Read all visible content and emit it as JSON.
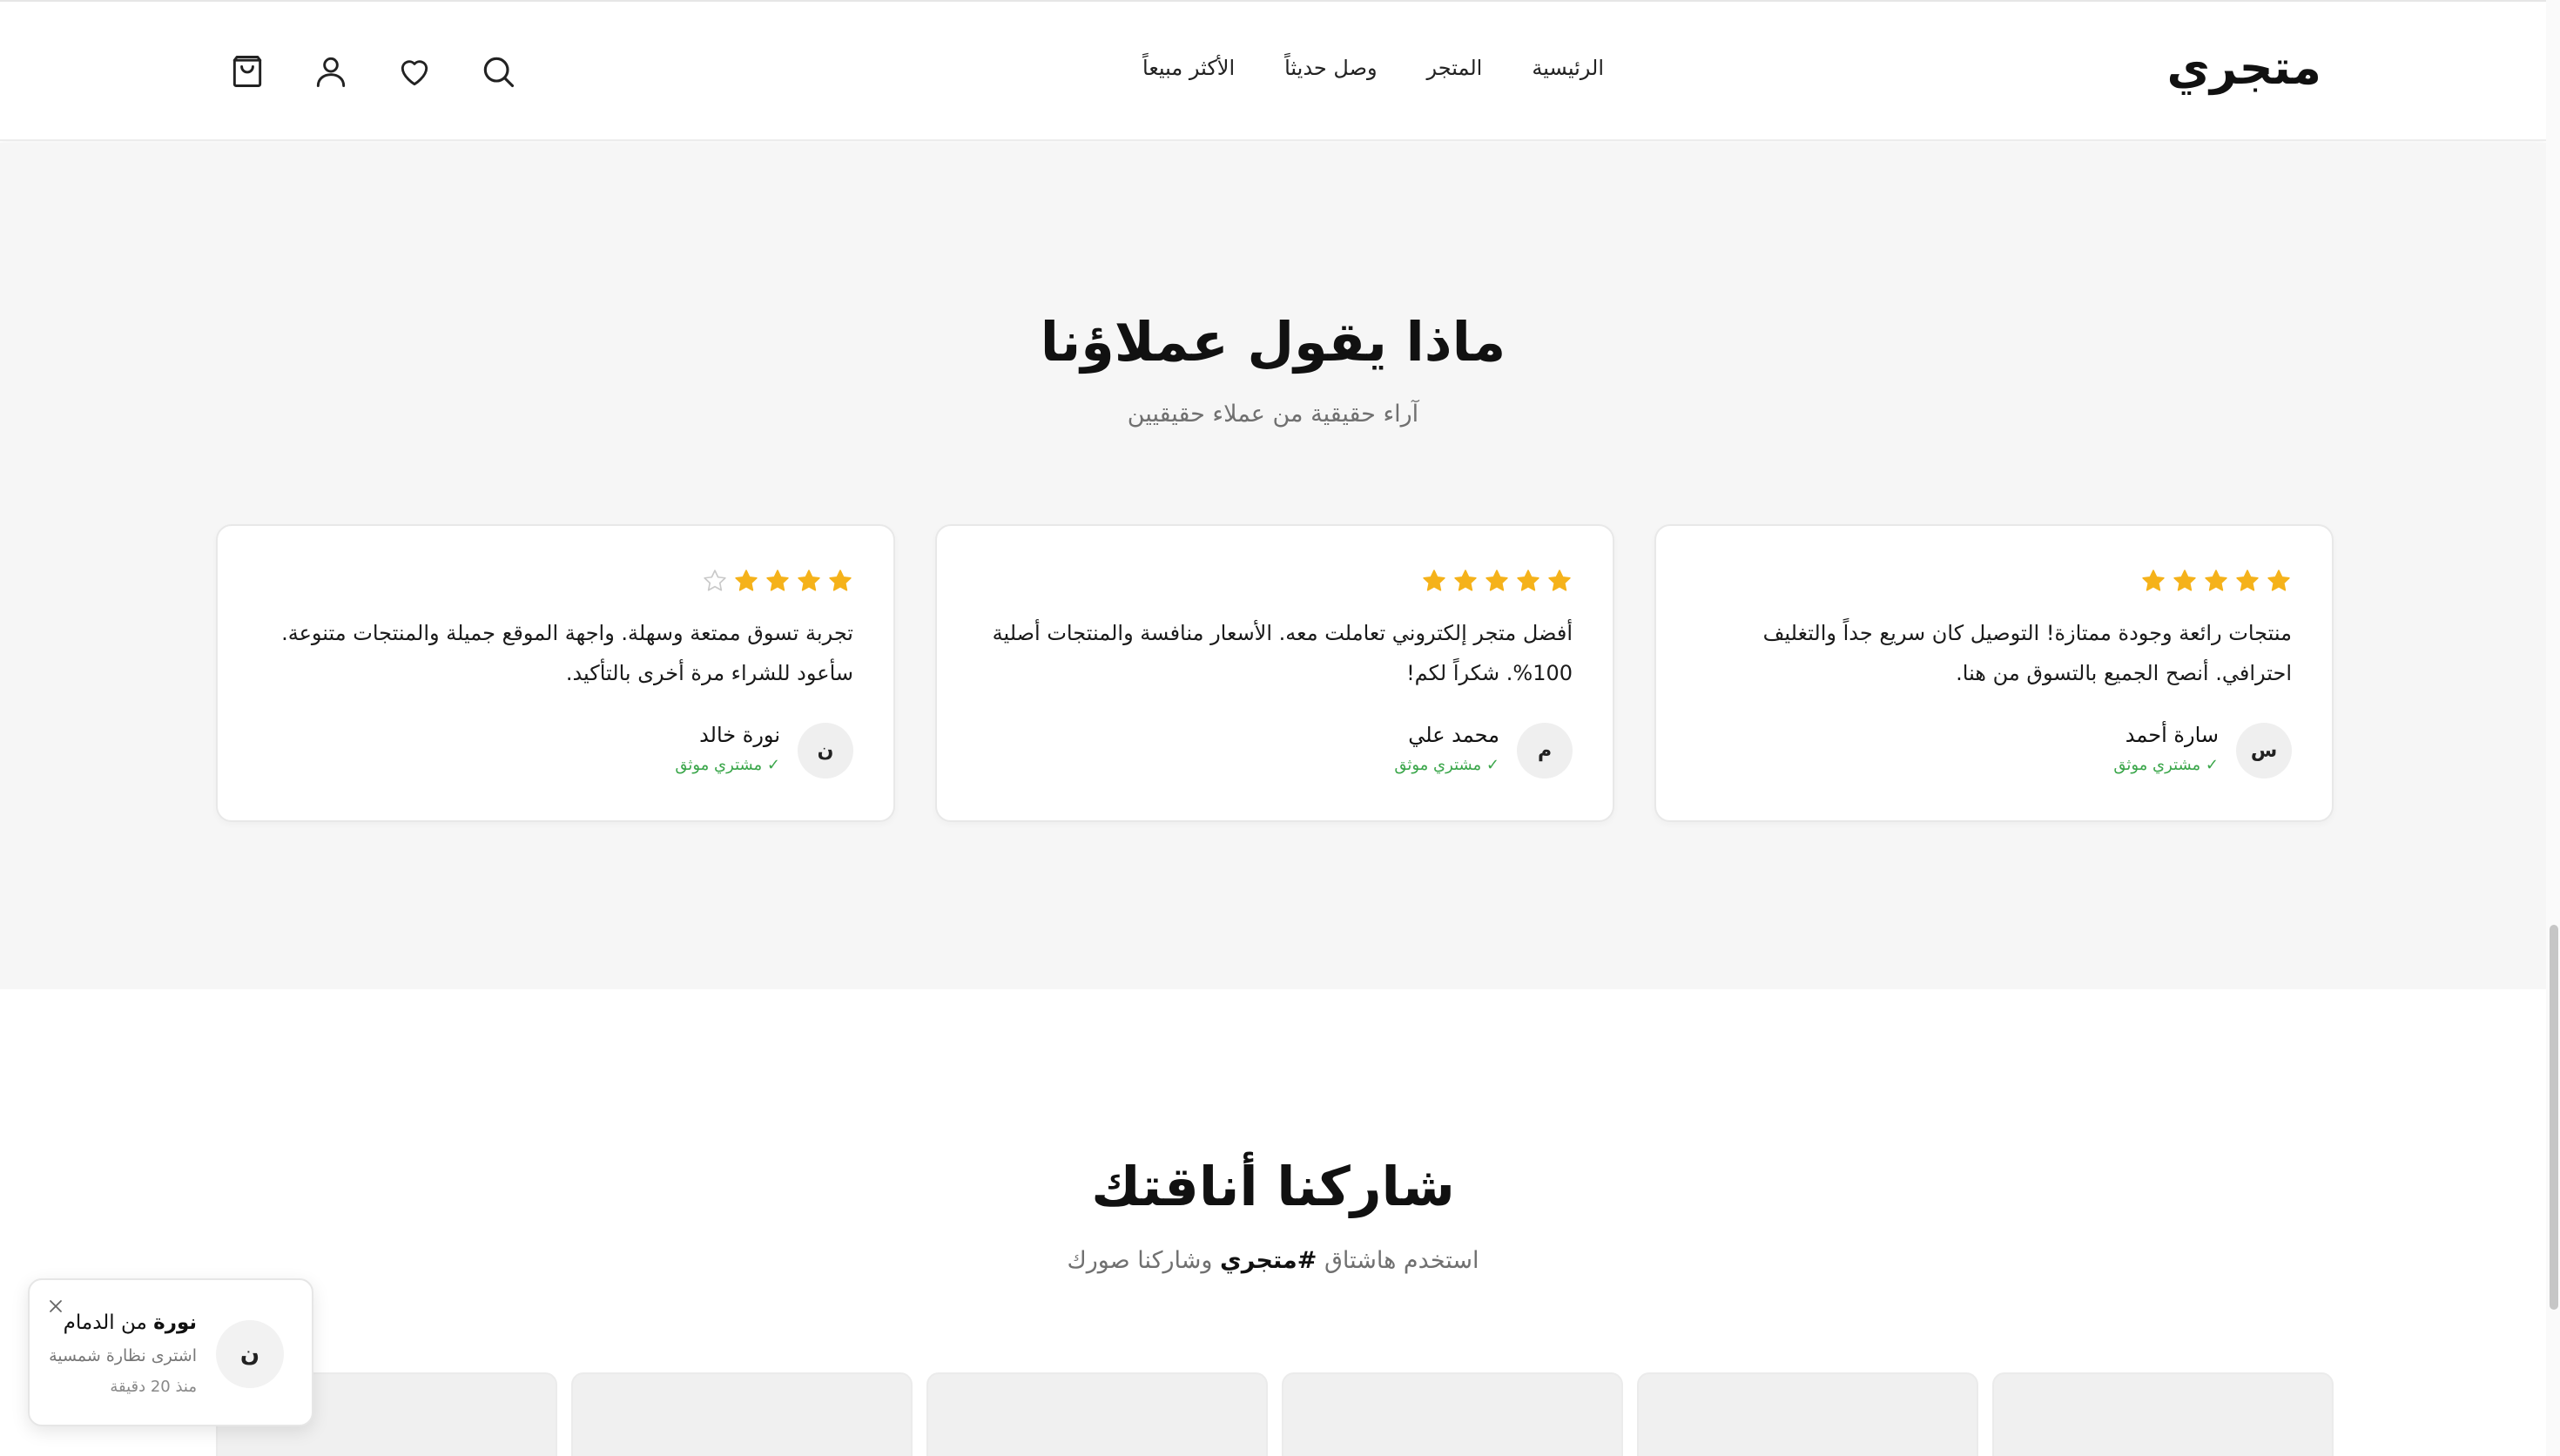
{
  "header": {
    "brand": "متجري",
    "nav": [
      "الرئيسية",
      "المتجر",
      "وصل حديثاً",
      "الأكثر مبيعاً"
    ],
    "icons": [
      "search-icon",
      "heart-icon",
      "user-icon",
      "shopping-bag-icon"
    ]
  },
  "testimonials": {
    "title": "ماذا يقول عملاؤنا",
    "subtitle": "آراء حقيقية من عملاء حقيقيين",
    "star_color": "#f5b21a",
    "items": [
      {
        "rating": 5,
        "text": "منتجات رائعة وجودة ممتازة! التوصيل كان سريع جداً والتغليف احترافي. أنصح الجميع بالتسوق من هنا.",
        "initial": "س",
        "name": "سارة أحمد",
        "badge": "✓ مشتري موثق"
      },
      {
        "rating": 5,
        "text": "أفضل متجر إلكتروني تعاملت معه. الأسعار منافسة والمنتجات أصلية 100%. شكراً لكم!",
        "initial": "م",
        "name": "محمد علي",
        "badge": "✓ مشتري موثق"
      },
      {
        "rating": 4,
        "text": "تجربة تسوق ممتعة وسهلة. واجهة الموقع جميلة والمنتجات متنوعة. سأعود للشراء مرة أخرى بالتأكيد.",
        "initial": "ن",
        "name": "نورة خالد",
        "badge": "✓ مشتري موثق"
      }
    ]
  },
  "share": {
    "title": "شاركنا أناقتك",
    "subtitle_before": "استخدم هاشتاق",
    "hashtag": "#متجري",
    "subtitle_after": "وشاركنا صورك"
  },
  "toast": {
    "name": "نورة",
    "city": "من الدمام",
    "action": "اشترى نظارة شمسية",
    "time": "منذ 20 دقيقة",
    "initial": "ن"
  }
}
